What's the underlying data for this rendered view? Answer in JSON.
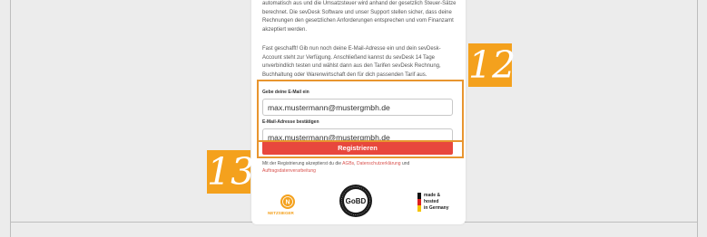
{
  "intro": {
    "paragraph1": "automatisch aus und die Umsatzsteuer wird anhand der gesetzlich Steuer-Sätze berechnet. Die sevDesk Software und unser Support stellen sicher, dass deine Rechnungen den gesetzlichen Anforderungen entsprechen und vom Finanzamt akzeptiert werden.",
    "paragraph2": "Fast geschafft! Gib nun noch deine E-Mail-Adresse ein und dein sevDesk-Account steht zur Verfügung. Anschließend kannst du sevDesk 14 Tage unverbindlich testen und wählst dann aus den Tarifen sevDesk Rechnung, Buchhaltung oder Warenwirtschaft den für dich passenden Tarif aus."
  },
  "form": {
    "email_label": "Gebe deine E-Mail ein",
    "email_value": "max.mustermann@mustergmbh.de",
    "confirm_label": "E-Mail-Adresse bestätigen",
    "confirm_value": "max.mustermann@mustergmbh.de",
    "submit_label": "Registrieren"
  },
  "legal": {
    "prefix": "Mit der Registrierung akzeptierst du die ",
    "agb": "AGBs",
    "sep": ", ",
    "privacy": "Datenschutzerklärung",
    "and": " und ",
    "processing": "Auftragsdatenverarbeitung"
  },
  "badges": {
    "netzsieger": "NETZSIEGER",
    "gobd": "GoBD",
    "made_line1": "made &",
    "made_line2": "hosted",
    "made_line3": "in Germany"
  },
  "annotations": {
    "step_fields": "12",
    "step_button": "13"
  },
  "colors": {
    "accent": "#e8473d",
    "highlight": "#e8952f",
    "step_badge": "#f4a11d"
  }
}
